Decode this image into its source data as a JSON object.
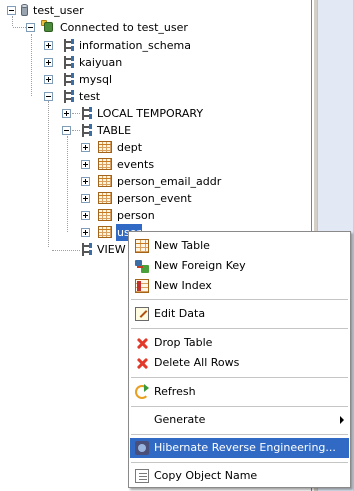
{
  "tree": {
    "root": "test_user",
    "connection": "Connected to test_user",
    "schemas": [
      "information_schema",
      "kaiyuan",
      "mysql",
      "test"
    ],
    "folders": [
      "LOCAL TEMPORARY",
      "TABLE",
      "VIEW"
    ],
    "tables": [
      "dept",
      "events",
      "person_email_addr",
      "person_event",
      "person",
      "user"
    ],
    "selected": "user"
  },
  "menu": {
    "items": [
      {
        "label": "New Table",
        "icon": "new-table-icon"
      },
      {
        "label": "New Foreign Key",
        "icon": "foreign-key-icon"
      },
      {
        "label": "New Index",
        "icon": "index-icon"
      },
      {
        "label": "Edit Data",
        "icon": "edit-data-icon"
      },
      {
        "label": "Drop Table",
        "icon": "red-x-icon"
      },
      {
        "label": "Delete All Rows",
        "icon": "red-x-icon"
      },
      {
        "label": "Refresh",
        "icon": "refresh-icon"
      },
      {
        "label": "Generate",
        "icon": "submenu-arrow-icon"
      },
      {
        "label": "Hibernate Reverse Engineering...",
        "icon": "hibernate-icon"
      },
      {
        "label": "Copy Object Name",
        "icon": "copy-icon"
      }
    ],
    "highlighted": "Hibernate Reverse Engineering...",
    "highlight_color": "#316ac5"
  }
}
